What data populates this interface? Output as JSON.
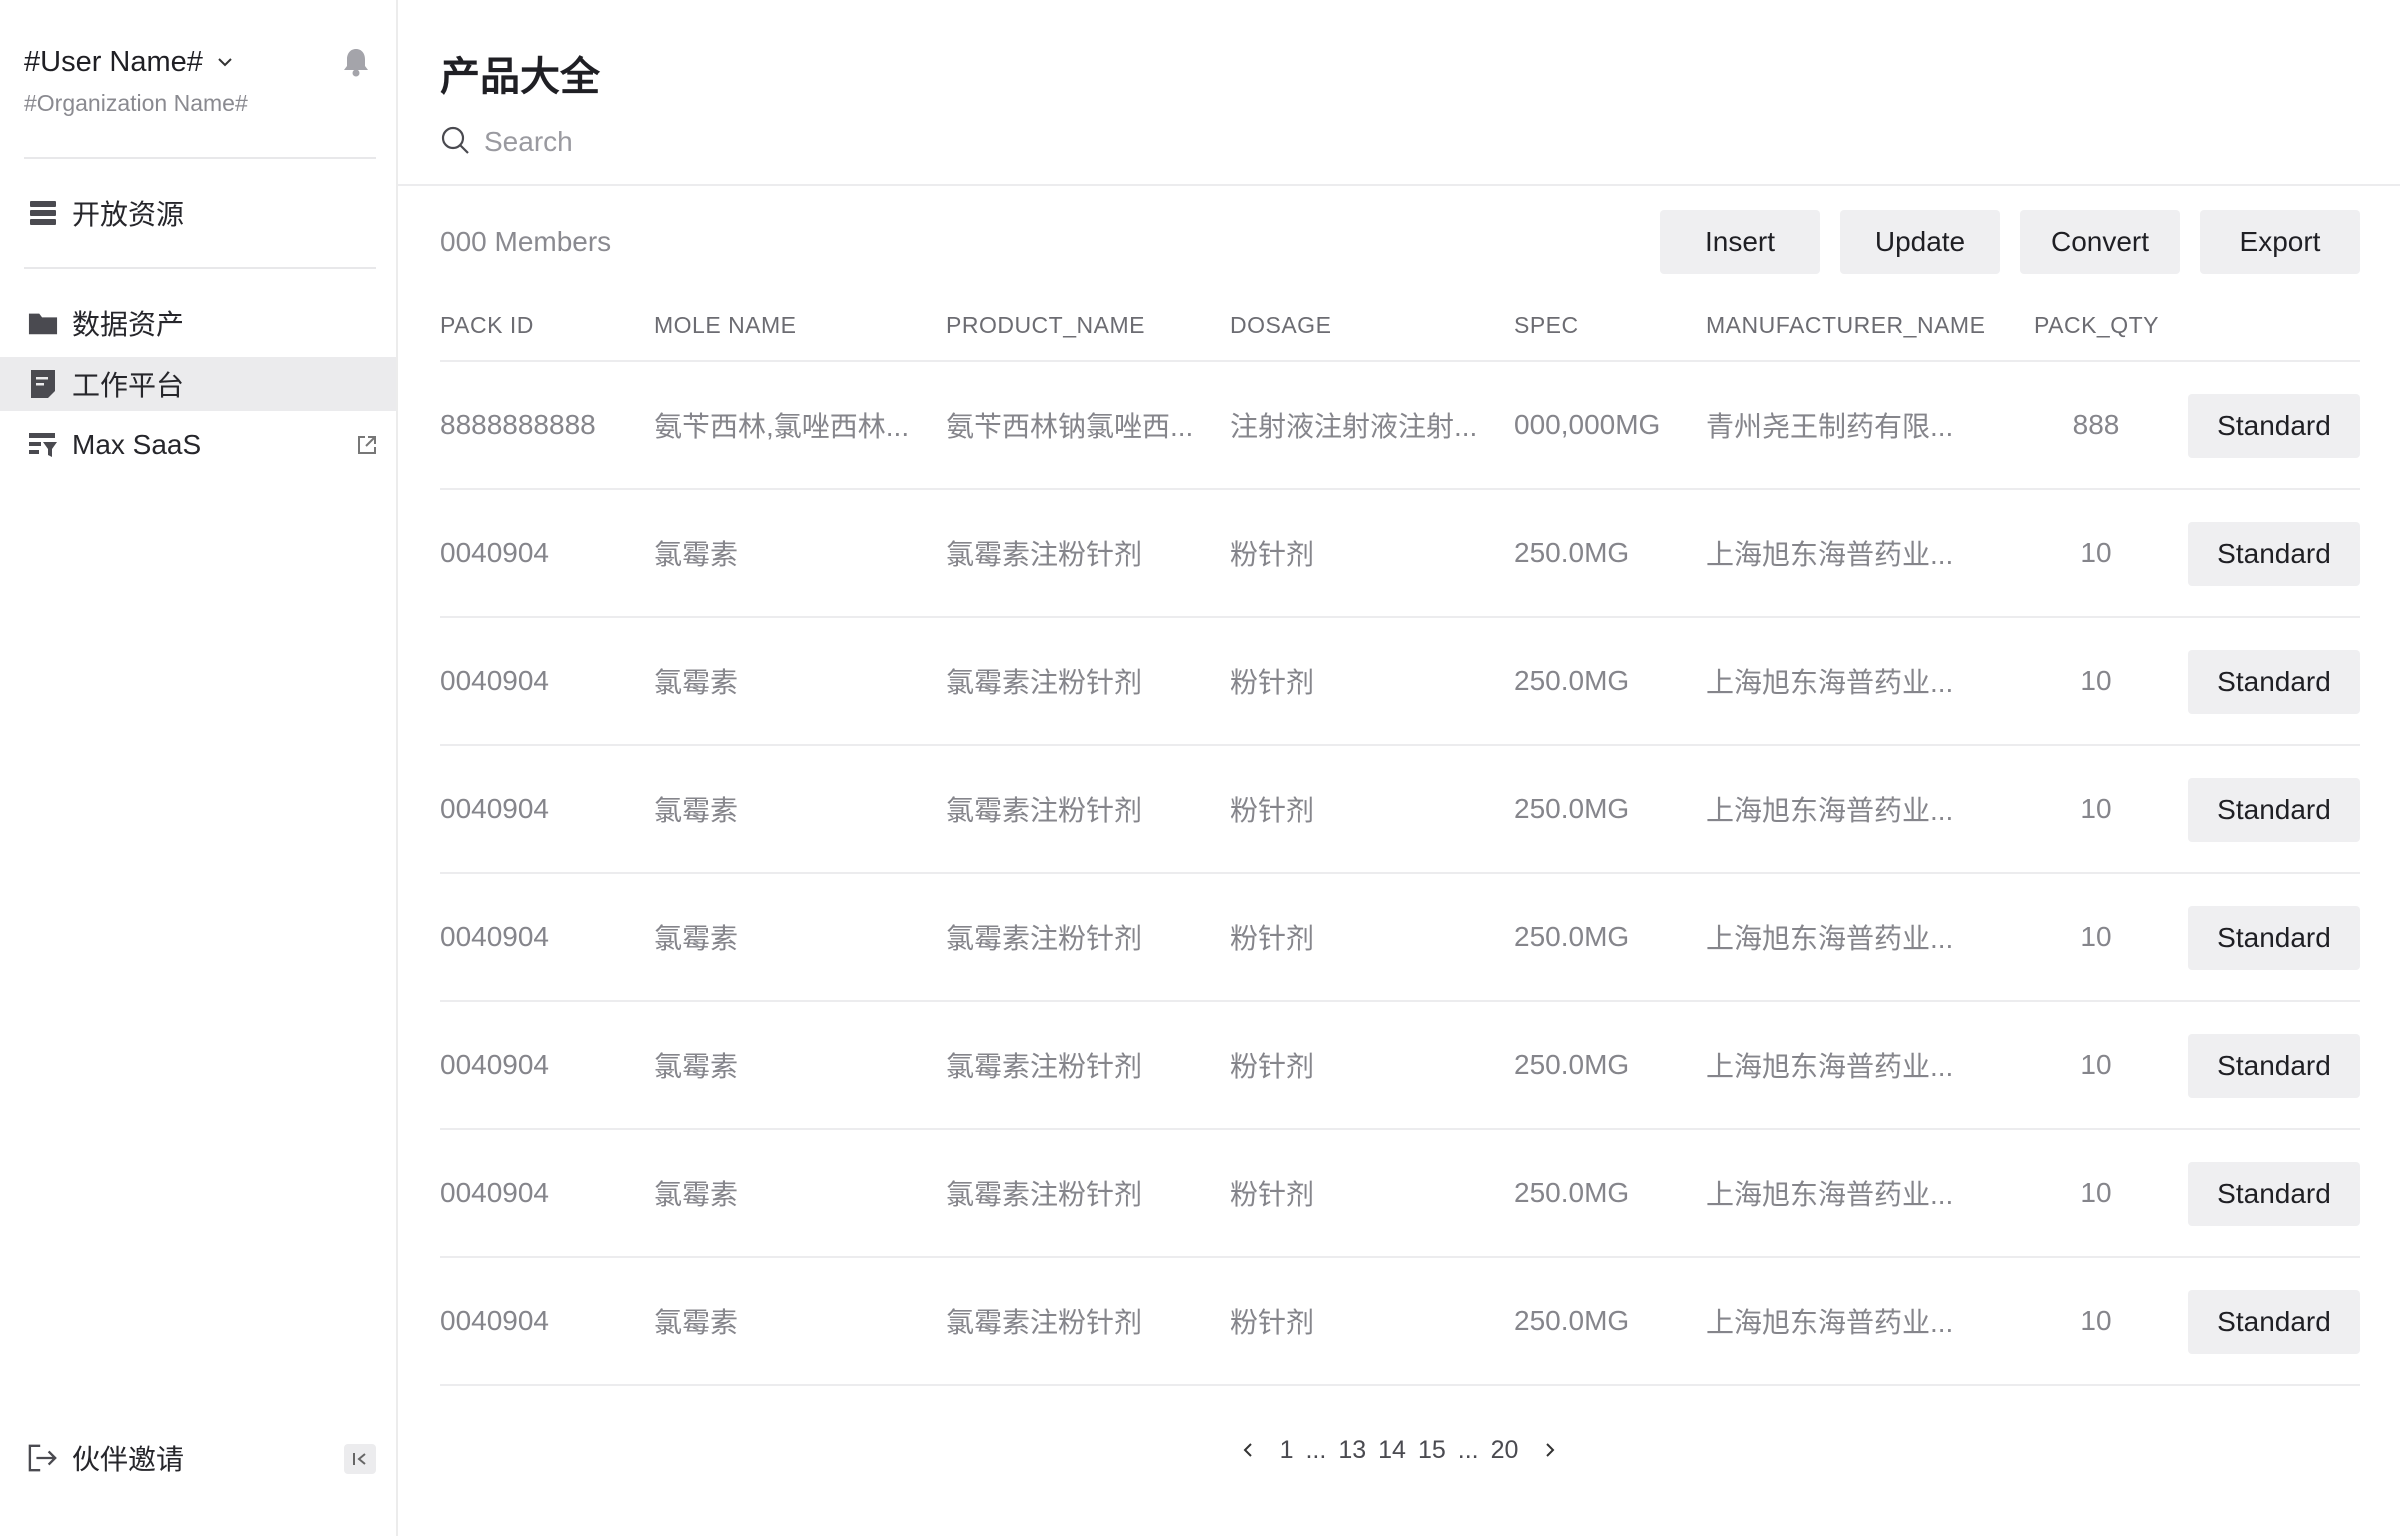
{
  "sidebar": {
    "user_name": "#User Name#",
    "org_name": "#Organization Name#",
    "items": [
      {
        "label": "开放资源",
        "icon": "list-icon"
      },
      {
        "label": "数据资产",
        "icon": "folder-icon"
      },
      {
        "label": "工作平台",
        "icon": "document-icon",
        "active": true
      },
      {
        "label": "Max SaaS",
        "icon": "filter-list-icon",
        "external": true
      }
    ],
    "invite_label": "伙伴邀请"
  },
  "main": {
    "title": "产品大全",
    "search_placeholder": "Search",
    "members_label": "000 Members",
    "actions": {
      "insert": "Insert",
      "update": "Update",
      "convert": "Convert",
      "export": "Export"
    },
    "columns": [
      "PACK ID",
      "MOLE NAME",
      "PRODUCT_NAME",
      "DOSAGE",
      "SPEC",
      "MANUFACTURER_NAME",
      "PACK_QTY"
    ],
    "rows": [
      {
        "pack_id": "8888888888",
        "mole_name": "氨苄西林,氯唑西林...",
        "product_name": "氨苄西林钠氯唑西...",
        "dosage": "注射液注射液注射...",
        "spec": "000,000MG",
        "manufacturer": "青州尧王制药有限...",
        "pack_qty": "888",
        "action": "Standard"
      },
      {
        "pack_id": "0040904",
        "mole_name": "氯霉素",
        "product_name": "氯霉素注粉针剂",
        "dosage": "粉针剂",
        "spec": "250.0MG",
        "manufacturer": "上海旭东海普药业...",
        "pack_qty": "10",
        "action": "Standard"
      },
      {
        "pack_id": "0040904",
        "mole_name": "氯霉素",
        "product_name": "氯霉素注粉针剂",
        "dosage": "粉针剂",
        "spec": "250.0MG",
        "manufacturer": "上海旭东海普药业...",
        "pack_qty": "10",
        "action": "Standard"
      },
      {
        "pack_id": "0040904",
        "mole_name": "氯霉素",
        "product_name": "氯霉素注粉针剂",
        "dosage": "粉针剂",
        "spec": "250.0MG",
        "manufacturer": "上海旭东海普药业...",
        "pack_qty": "10",
        "action": "Standard"
      },
      {
        "pack_id": "0040904",
        "mole_name": "氯霉素",
        "product_name": "氯霉素注粉针剂",
        "dosage": "粉针剂",
        "spec": "250.0MG",
        "manufacturer": "上海旭东海普药业...",
        "pack_qty": "10",
        "action": "Standard"
      },
      {
        "pack_id": "0040904",
        "mole_name": "氯霉素",
        "product_name": "氯霉素注粉针剂",
        "dosage": "粉针剂",
        "spec": "250.0MG",
        "manufacturer": "上海旭东海普药业...",
        "pack_qty": "10",
        "action": "Standard"
      },
      {
        "pack_id": "0040904",
        "mole_name": "氯霉素",
        "product_name": "氯霉素注粉针剂",
        "dosage": "粉针剂",
        "spec": "250.0MG",
        "manufacturer": "上海旭东海普药业...",
        "pack_qty": "10",
        "action": "Standard"
      },
      {
        "pack_id": "0040904",
        "mole_name": "氯霉素",
        "product_name": "氯霉素注粉针剂",
        "dosage": "粉针剂",
        "spec": "250.0MG",
        "manufacturer": "上海旭东海普药业...",
        "pack_qty": "10",
        "action": "Standard"
      }
    ],
    "pagination": [
      "1",
      "...",
      "13",
      "14",
      "15",
      "...",
      "20"
    ]
  },
  "colors": {
    "sidebar_active": "#ebebed",
    "button_bg": "#efeff1",
    "divider": "#ececee",
    "muted_text": "#85858b"
  }
}
